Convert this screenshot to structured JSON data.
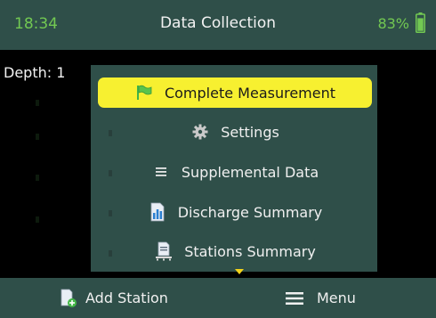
{
  "status": {
    "time": "18:34",
    "title": "Data Collection",
    "battery_text": "83%",
    "battery_level": 0.83
  },
  "depth_label": "Depth: 1",
  "menu": {
    "items": [
      {
        "label": "Complete Measurement",
        "icon": "flag-icon",
        "selected": true
      },
      {
        "label": "Settings",
        "icon": "gear-icon",
        "selected": false
      },
      {
        "label": "Supplemental Data",
        "icon": "list-icon",
        "selected": false
      },
      {
        "label": "Discharge Summary",
        "icon": "chart-document-icon",
        "selected": false
      },
      {
        "label": "Stations Summary",
        "icon": "stations-document-icon",
        "selected": false
      }
    ],
    "more_indicator": "chevron-down-icon"
  },
  "softkeys": {
    "left_label": "Add Station",
    "left_icon": "add-document-icon",
    "right_label": "Menu",
    "right_icon": "hamburger-icon"
  },
  "colors": {
    "bar_bg": "#2f4f49",
    "accent_green": "#72c852",
    "highlight_yellow": "#f7f030",
    "screen_bg": "#000000"
  }
}
